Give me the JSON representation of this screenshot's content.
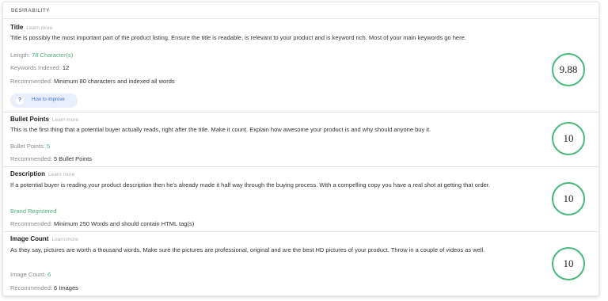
{
  "section_header": "DESIRABILITY",
  "learn_more": "Learn more",
  "rows": [
    {
      "title": "Title",
      "desc": "Title is possibly the most important part of the product listing. Ensure the title is readable, is relevant to your product and is keyword rich. Most of your main keywords go here.",
      "length_label": "Length:",
      "length_value": "78 Character(s)",
      "keywords_label": "Keywords Indexed:",
      "keywords_value": "12",
      "rec_label": "Recommended:",
      "rec_value": "Minimum 80 characters and indexed all words",
      "improve_icon": "?",
      "improve_label": "How to improve",
      "score": "9.88"
    },
    {
      "title": "Bullet Points",
      "desc": "This is the first thing that a potential buyer actually reads, right after the title. Make it count. Explain how awesome your product is and why should anyone buy it.",
      "metric_label": "Bullet Points:",
      "metric_value": "5",
      "rec_label": "Recommended:",
      "rec_value": "5 Bullet Points",
      "score": "10"
    },
    {
      "title": "Description",
      "desc": "If a potential buyer is reading your product description then he's already made it half way through the buying process. With a compelling copy you have a real shot at getting that order.",
      "status": "Brand Registered",
      "rec_label": "Recommended:",
      "rec_value": "Minimum 250 Words and should contain HTML tag(s)",
      "score": "10"
    },
    {
      "title": "Image Count",
      "desc": "As they say, pictures are worth a thousand words. Make sure the pictures are professional, original and are the best HD pictures of your product. Throw in a couple of videos as well.",
      "metric_label": "Image Count:",
      "metric_value": "6",
      "rec_label": "Recommended:",
      "rec_value": "6 Images",
      "score": "10"
    }
  ]
}
